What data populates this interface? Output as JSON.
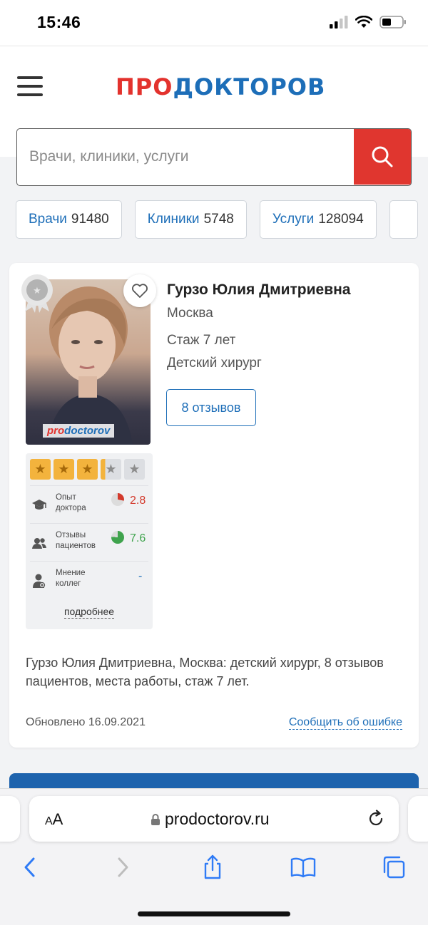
{
  "status_bar": {
    "time": "15:46"
  },
  "header": {
    "logo_part1": "ПРО",
    "logo_part2": "ДОКТОРОВ"
  },
  "search": {
    "placeholder": "Врачи, клиники, услуги"
  },
  "chips": [
    {
      "label": "Врачи",
      "count": "91480"
    },
    {
      "label": "Клиники",
      "count": "5748"
    },
    {
      "label": "Услуги",
      "count": "128094"
    }
  ],
  "doctor": {
    "name": "Гурзо Юлия Дмитриевна",
    "city": "Москва",
    "experience": "Стаж 7 лет",
    "specialty": "Детский хирург",
    "reviews_button": "8 отзывов",
    "photo_watermark_part1": "pro",
    "photo_watermark_part2": "doctorov",
    "stars_rating": 3.2,
    "stars_total": 5,
    "metrics": [
      {
        "label": "Опыт доктора",
        "value": "2.8",
        "color": "#d33a2c",
        "fill": 0.28
      },
      {
        "label": "Отзывы пациентов",
        "value": "7.6",
        "color": "#3fa34d",
        "fill": 0.76
      },
      {
        "label": "Мнение коллег",
        "value": "-",
        "color": "#1d6eb8",
        "fill": 0
      }
    ],
    "more_link": "подробнее",
    "description": "Гурзо Юлия Дмитриевна, Москва: детский хирург, 8 отзывов пациентов, места работы, стаж 7 лет.",
    "updated": "Обновлено 16.09.2021",
    "report_link": "Сообщить об ошибке"
  },
  "safari": {
    "aa_label_small": "A",
    "aa_label_big": "A",
    "url": "prodoctorov.ru"
  },
  "colors": {
    "brand_red": "#e3322d",
    "brand_blue": "#1d6eb8",
    "star_gold": "#f3b33d"
  }
}
